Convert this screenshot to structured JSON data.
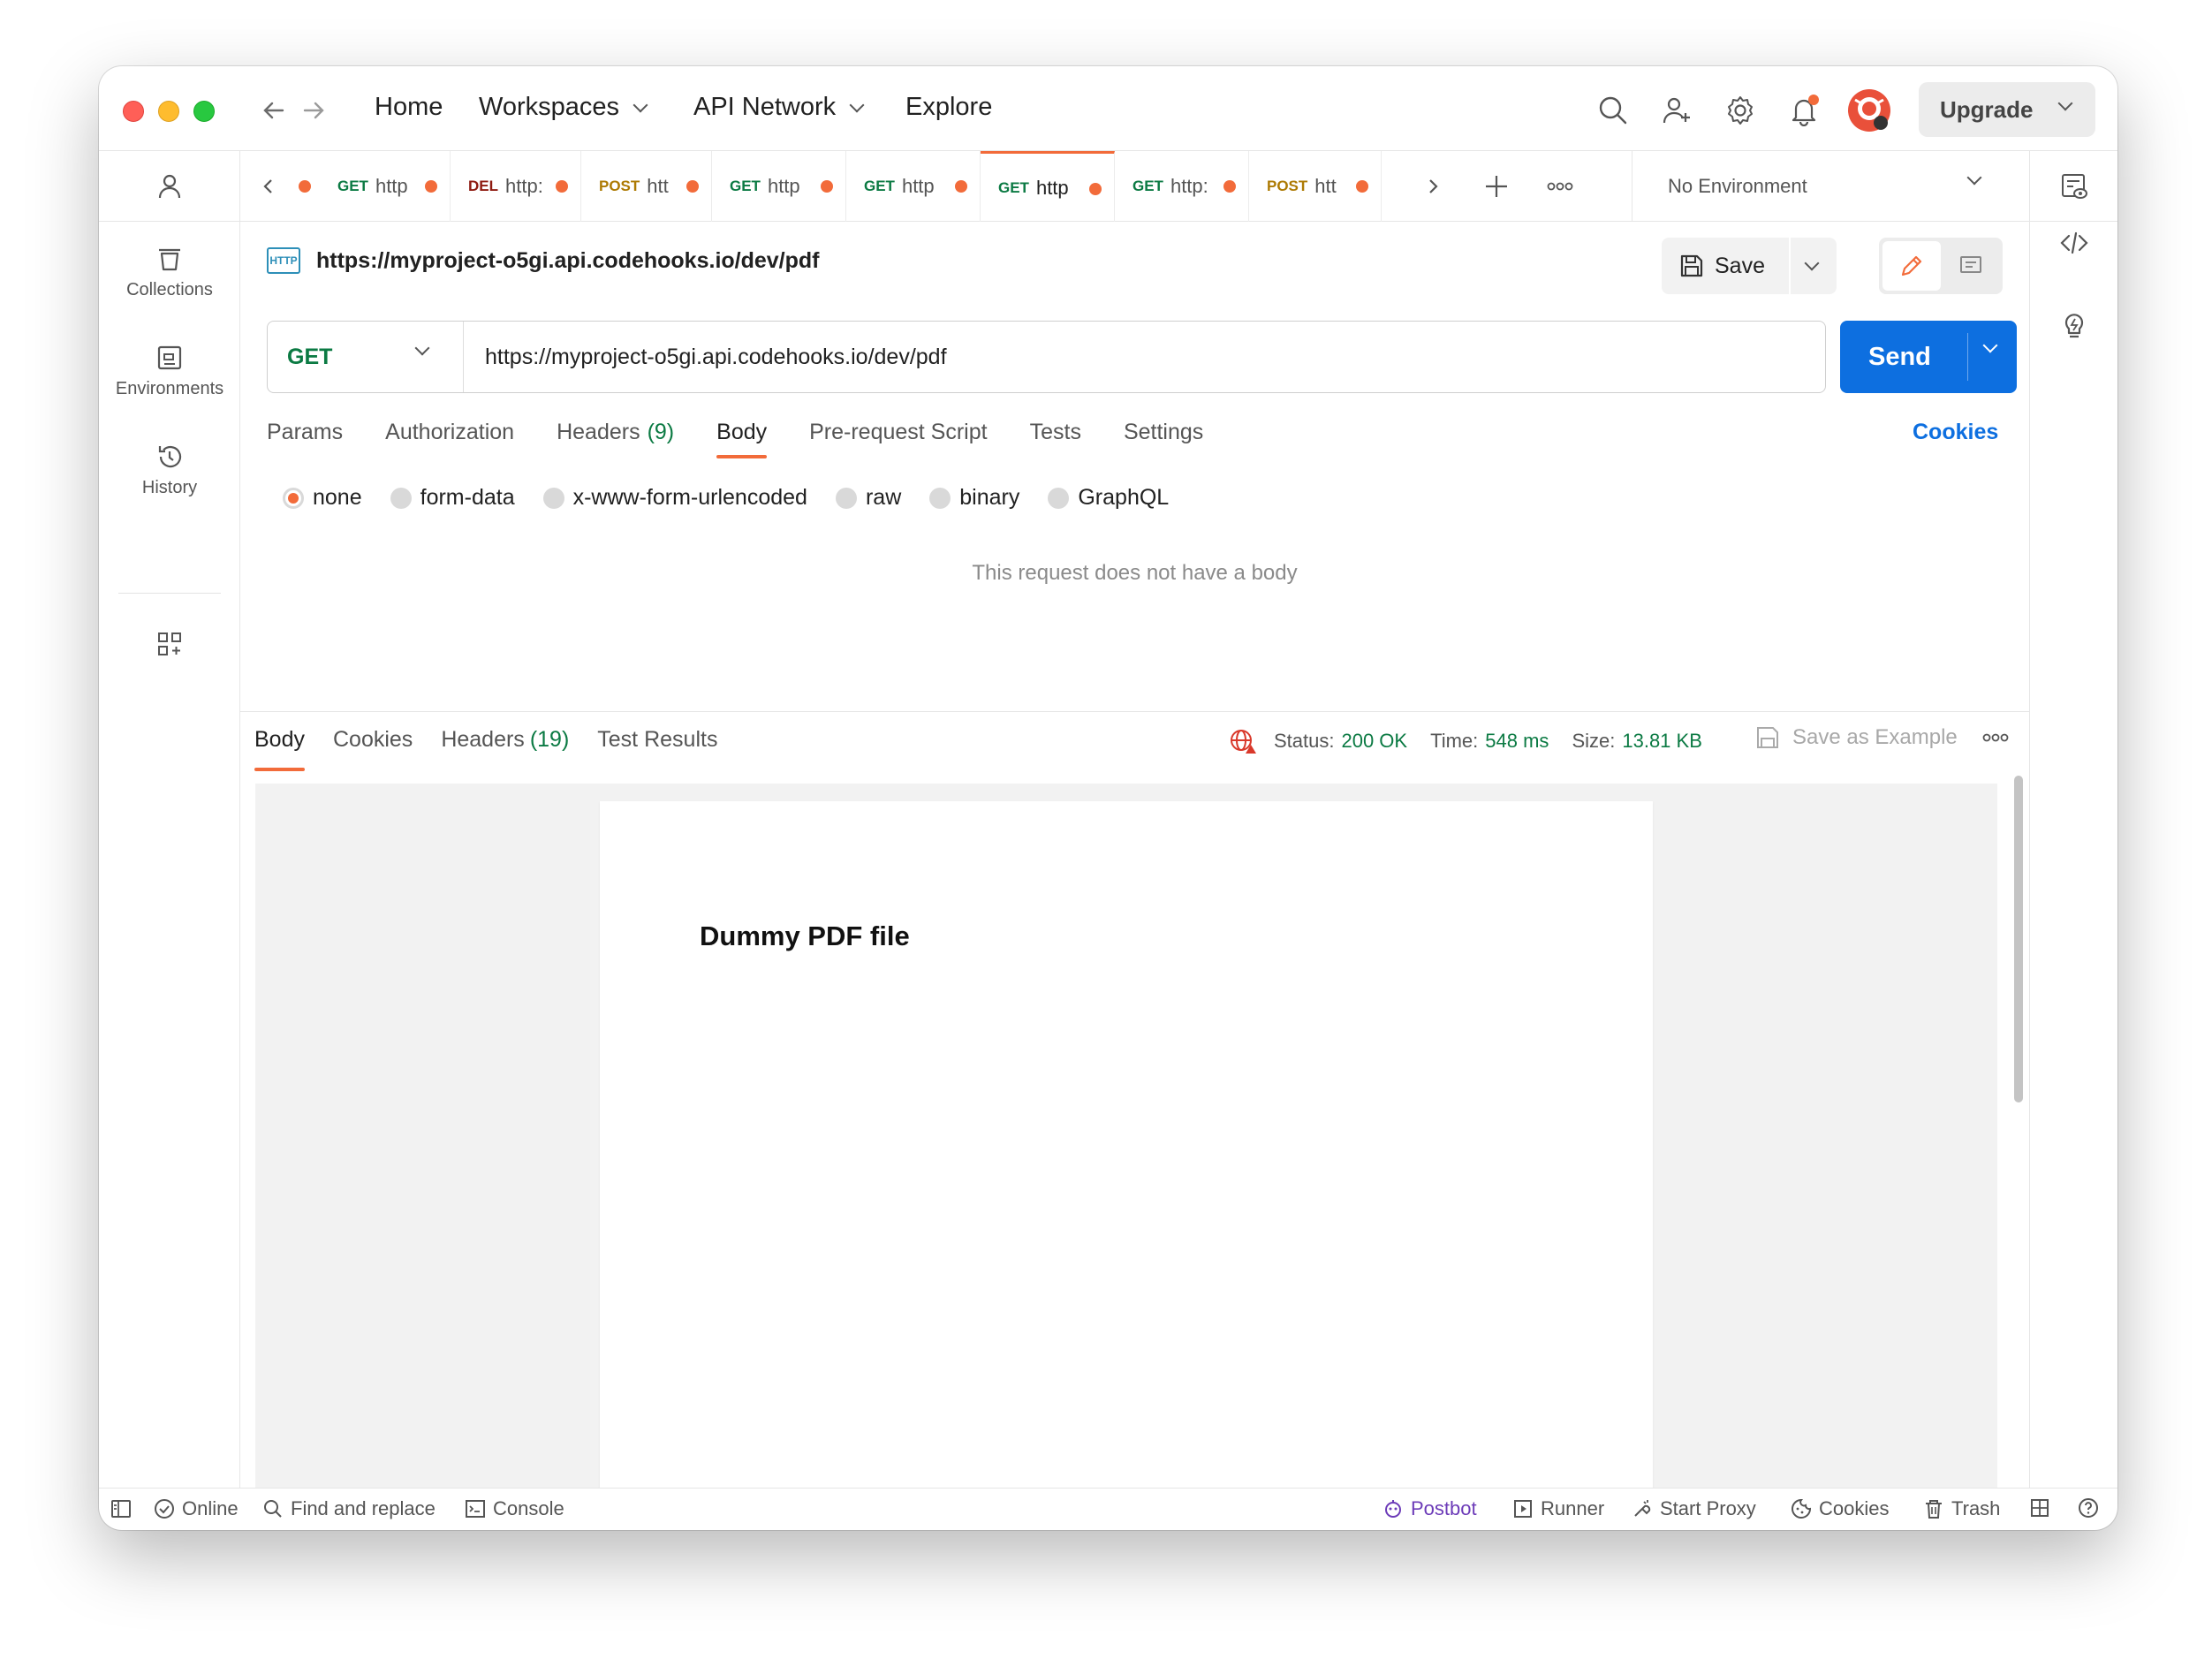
{
  "titlebar": {
    "nav": {
      "home": "Home",
      "workspaces": "Workspaces",
      "api_network": "API Network",
      "explore": "Explore"
    },
    "upgrade": "Upgrade"
  },
  "sidebar": {
    "items": [
      {
        "label": "Collections"
      },
      {
        "label": "Environments"
      },
      {
        "label": "History"
      }
    ]
  },
  "tabs": [
    {
      "method": "GET",
      "url": "http"
    },
    {
      "method": "DEL",
      "url": "http:"
    },
    {
      "method": "POST",
      "url": "htt"
    },
    {
      "method": "GET",
      "url": "http"
    },
    {
      "method": "GET",
      "url": "http"
    },
    {
      "method": "GET",
      "url": "http",
      "active": true
    },
    {
      "method": "GET",
      "url": "http:"
    },
    {
      "method": "POST",
      "url": "htt"
    }
  ],
  "environment": "No Environment",
  "request": {
    "title": "https://myproject-o5gi.api.codehooks.io/dev/pdf",
    "http_badge": "HTTP",
    "save_label": "Save",
    "method": "GET",
    "url": "https://myproject-o5gi.api.codehooks.io/dev/pdf",
    "send_label": "Send",
    "tabs": {
      "params": "Params",
      "authorization": "Authorization",
      "headers": "Headers",
      "headers_count": "(9)",
      "body": "Body",
      "prerequest": "Pre-request Script",
      "tests": "Tests",
      "settings": "Settings"
    },
    "cookies_link": "Cookies",
    "body_types": [
      "none",
      "form-data",
      "x-www-form-urlencoded",
      "raw",
      "binary",
      "GraphQL"
    ],
    "no_body_text": "This request does not have a body"
  },
  "response": {
    "tabs": {
      "body": "Body",
      "cookies": "Cookies",
      "headers": "Headers",
      "headers_count": "(19)",
      "test_results": "Test Results"
    },
    "status_label": "Status:",
    "status_value": "200 OK",
    "time_label": "Time:",
    "time_value": "548 ms",
    "size_label": "Size:",
    "size_value": "13.81 KB",
    "save_example": "Save as Example",
    "pdf_text": "Dummy PDF file"
  },
  "statusbar": {
    "online": "Online",
    "find_replace": "Find and replace",
    "console": "Console",
    "postbot": "Postbot",
    "runner": "Runner",
    "start_proxy": "Start Proxy",
    "cookies": "Cookies",
    "trash": "Trash"
  },
  "colors": {
    "accent": "#f26b3a",
    "send": "#0d6fe0",
    "get": "#0b7a43",
    "del": "#8e1a10",
    "post": "#ad7a03"
  }
}
